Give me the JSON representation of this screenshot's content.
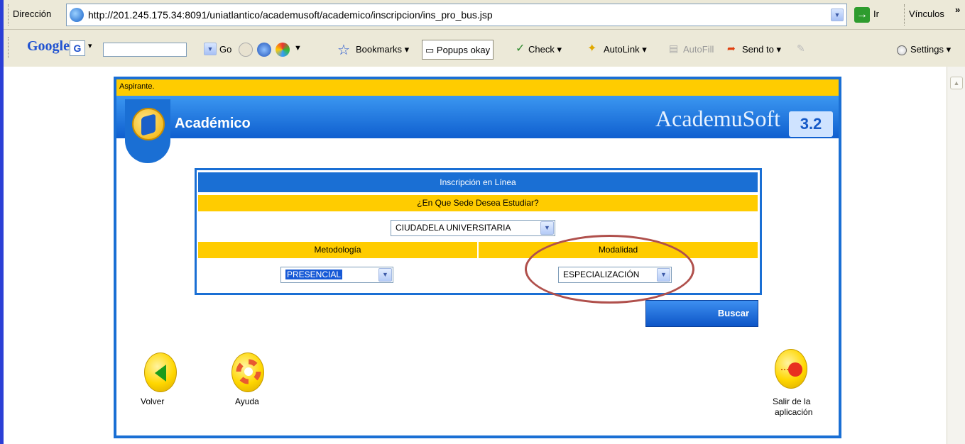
{
  "browser": {
    "address_label": "Dirección",
    "url": "http://201.245.175.34:8091/uniatlantico/academusoft/academico/inscripcion/ins_pro_bus.jsp",
    "go_label": "Ir",
    "links_label": "Vínculos",
    "links_chevron": "»",
    "google_logo": "Google",
    "google_g": "G",
    "go_search_label": "Go",
    "toolbar": {
      "bookmarks": "Bookmarks",
      "popups": "Popups okay",
      "check": "Check",
      "autolink": "AutoLink",
      "autofill": "AutoFill",
      "send_to": "Send to",
      "settings": "Settings"
    }
  },
  "app": {
    "user_role": "Aspirante.",
    "module_title": "Académico",
    "brand": "AcademuSoft",
    "version": "3.2"
  },
  "form": {
    "title": "Inscripción en Línea",
    "sede_question": "¿En Que Sede Desea Estudiar?",
    "sede_value": "CIUDADELA UNIVERSITARIA",
    "metodologia_label": "Metodología",
    "metodologia_value": "PRESENCIAL",
    "modalidad_label": "Modalidad",
    "modalidad_value": "ESPECIALIZACIÓN",
    "buscar_label": "Buscar"
  },
  "nav": {
    "volver": "Volver",
    "ayuda": "Ayuda",
    "salir_line1": "Salir de la",
    "salir_line2": "aplicación"
  },
  "colors": {
    "brand_blue": "#1a6fd4",
    "gold": "#ffcc00",
    "annotation": "#b0504c"
  },
  "icons": [
    "ie-page-icon",
    "go-arrow-icon",
    "back-arrow-icon",
    "lifebuoy-icon",
    "exit-icon",
    "academico-logo-icon"
  ]
}
